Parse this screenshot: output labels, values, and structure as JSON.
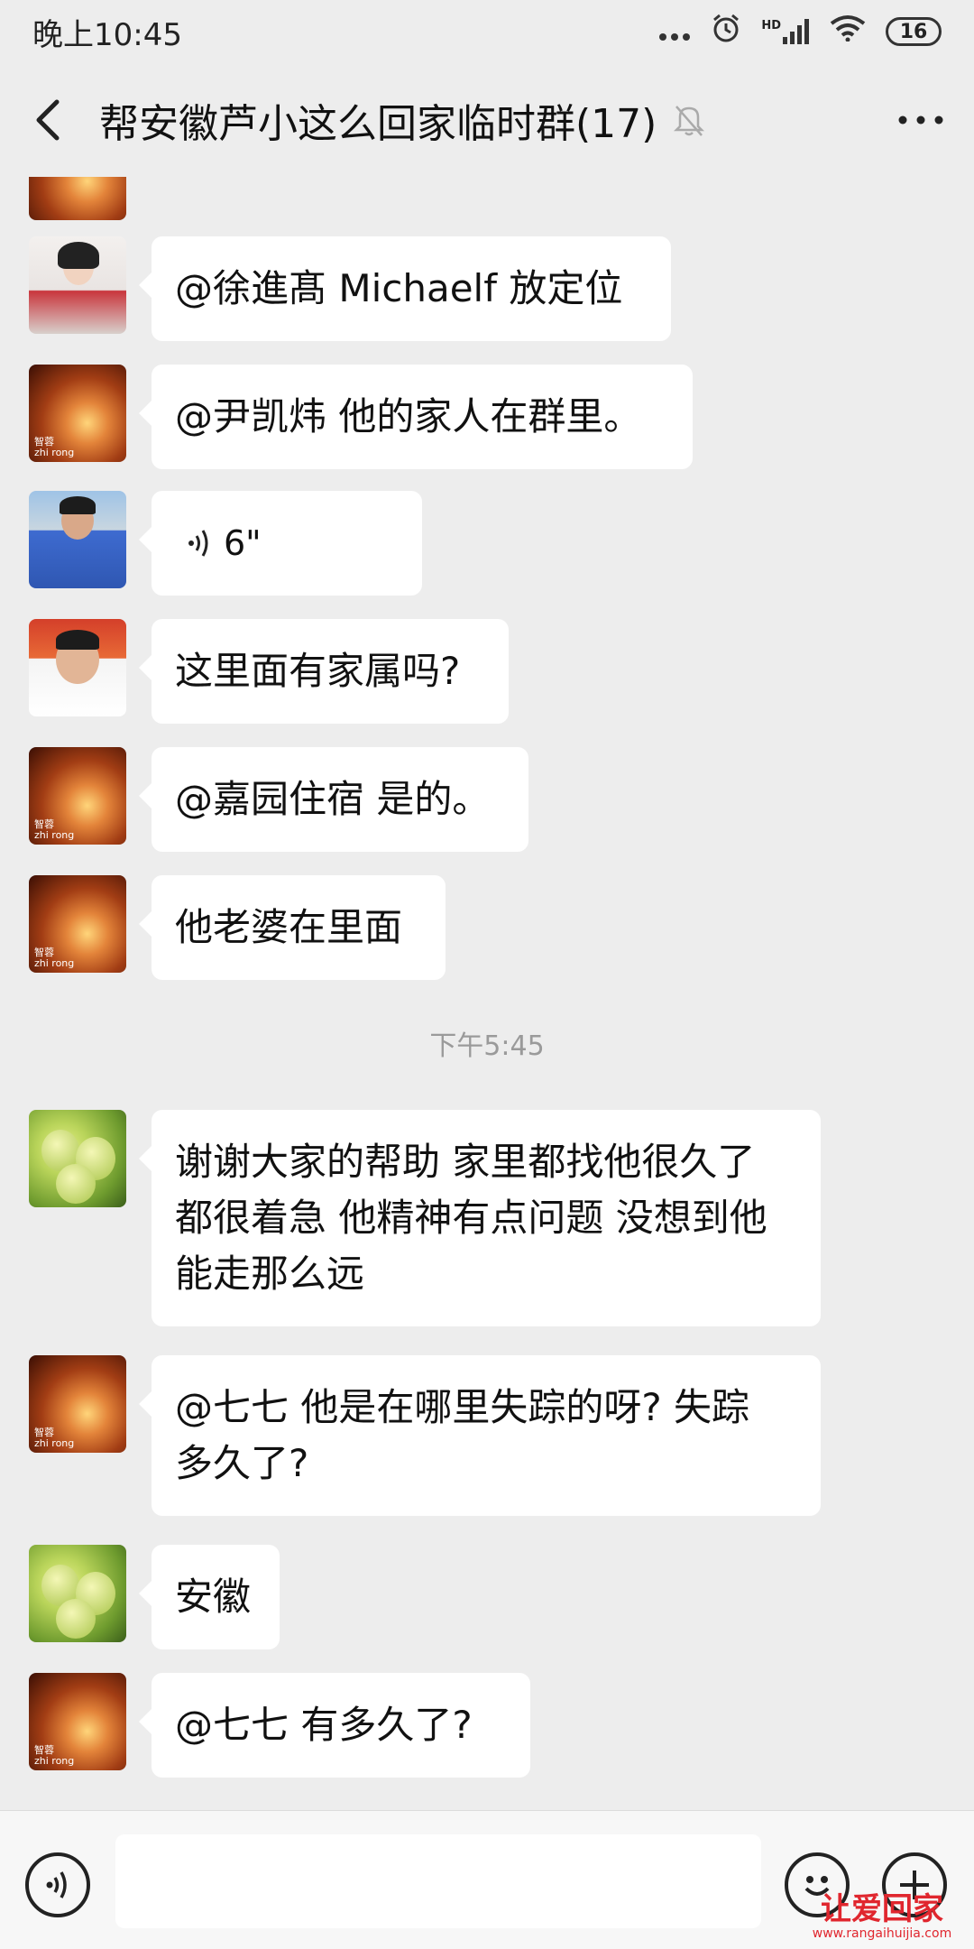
{
  "status_bar": {
    "time": "晚上10:45",
    "network": "HD",
    "battery": "16"
  },
  "header": {
    "title": "帮安徽芦小这么回家临时群(17)"
  },
  "messages": [
    {
      "type": "text",
      "avatar": "hand",
      "text": "@徐進髙 Michaelf  放定位"
    },
    {
      "type": "text",
      "avatar": "hand",
      "text": "@尹凯炜  他的家人在群里。"
    },
    {
      "type": "voice",
      "avatar": "man-blue",
      "duration": "6\""
    },
    {
      "type": "text",
      "avatar": "man-orange",
      "text": "这里面有家属吗?"
    },
    {
      "type": "text",
      "avatar": "hand",
      "text": "@嘉园住宿  是的。"
    },
    {
      "type": "text",
      "avatar": "hand",
      "text": "他老婆在里面"
    },
    {
      "type": "time",
      "text": "下午5:45"
    },
    {
      "type": "text",
      "avatar": "pear",
      "lines": [
        "谢谢大家的帮助 家里都找他很久了",
        "都很着急 他精神有点问题 没想到他",
        "能走那么远"
      ]
    },
    {
      "type": "text",
      "avatar": "hand",
      "lines": [
        "@七七  他是在哪里失踪的呀? 失踪",
        "多久了?"
      ]
    },
    {
      "type": "text",
      "avatar": "pear",
      "text": "安徽"
    },
    {
      "type": "text",
      "avatar": "hand",
      "text": "@七七  有多久了?"
    }
  ],
  "avatar_label": {
    "line1": "智蓉",
    "line2": "zhi rong"
  },
  "watermark": {
    "title": "让爱回家",
    "url": "www.rangaihuijia.com"
  },
  "colors": {
    "background": "#ededed",
    "bubble": "#ffffff",
    "watermark": "#e0262e"
  }
}
